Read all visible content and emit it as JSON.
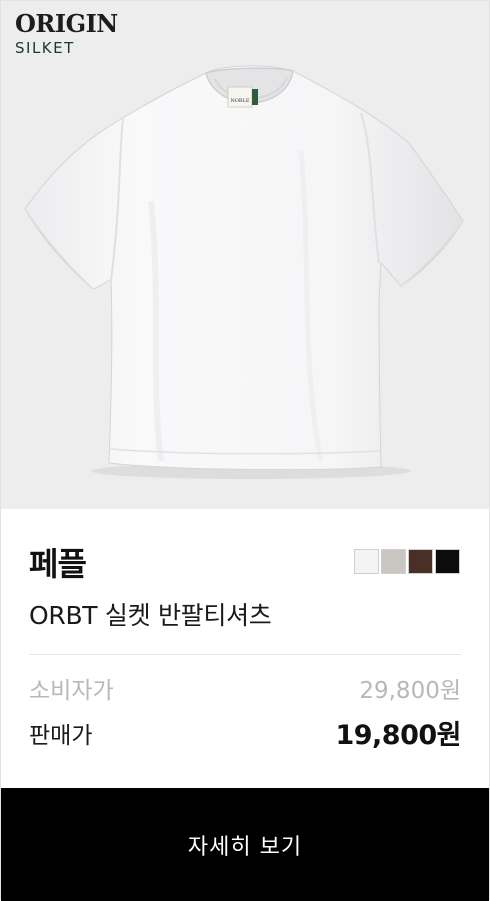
{
  "brand_logo": {
    "line1": "ORIGIN",
    "line2": "SILKET"
  },
  "shirt_label": "NOBLE",
  "product": {
    "maker": "페플",
    "name": "ORBT 실켓 반팔티셔츠",
    "colors": [
      "#f4f4f4",
      "#cac6c2",
      "#4a2f27",
      "#0c0c0c"
    ]
  },
  "pricing": {
    "list_label": "소비자가",
    "list_price": "29,800원",
    "sale_label": "판매가",
    "sale_price": "19,800원"
  },
  "cta": {
    "label": "자세히 보기"
  }
}
